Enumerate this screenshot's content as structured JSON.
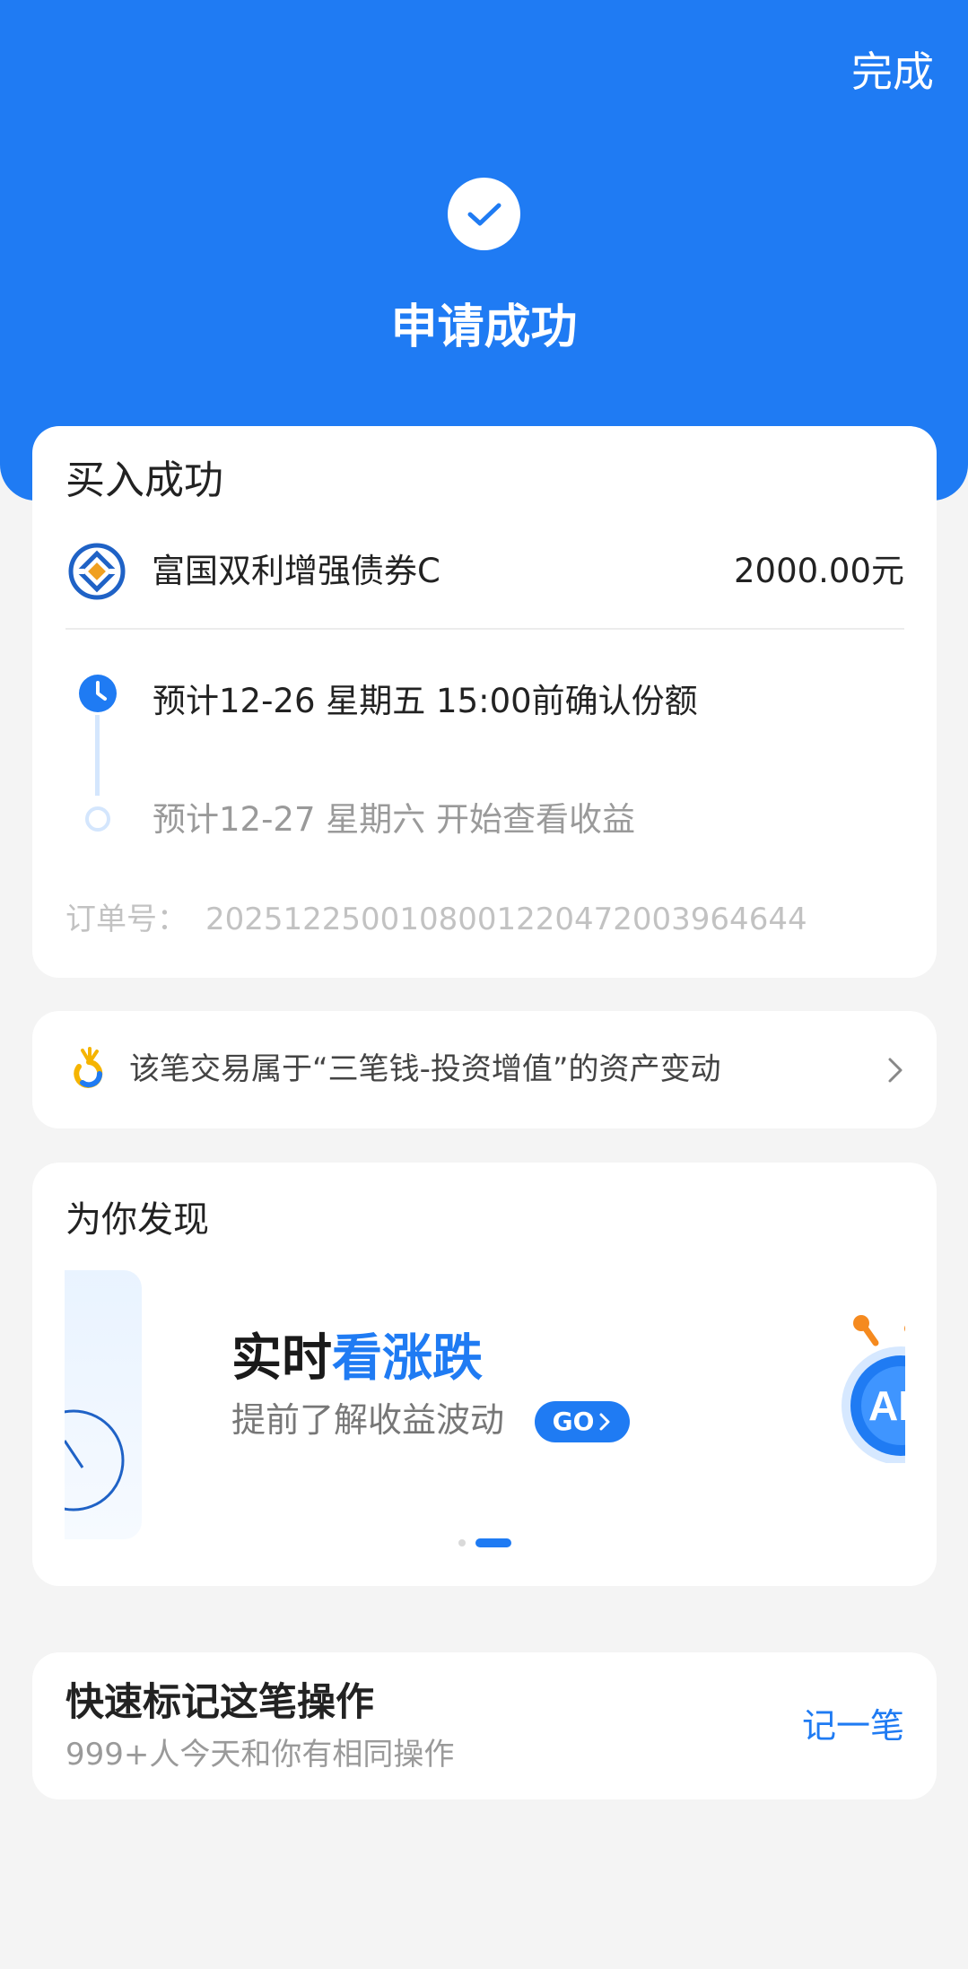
{
  "header": {
    "done_label": "完成",
    "status_title": "申请成功"
  },
  "order": {
    "title": "买入成功",
    "fund_name": "富国双利增强债券C",
    "amount": "2000.00元",
    "steps": [
      {
        "text": "预计12-26 星期五 15:00前确认份额",
        "active": true
      },
      {
        "text": "预计12-27 星期六 开始查看收益",
        "active": false
      }
    ],
    "order_no_label": "订单号：",
    "order_no": "2025122500108001220472003964644"
  },
  "asset_notice": {
    "text": "该笔交易属于“三笔钱-投资增值”的资产变动"
  },
  "discover": {
    "title": "为你发现",
    "banner": {
      "headline_part1": "实时",
      "headline_part2": "看涨跌",
      "subtitle": "提前了解收益波动",
      "go_label": "GO",
      "ai_badge": "AI"
    },
    "carousel": {
      "count": 2,
      "active_index": 1
    }
  },
  "quick_mark": {
    "title": "快速标记这笔操作",
    "subtitle": "999+人今天和你有相同操作",
    "action_label": "记一笔"
  },
  "colors": {
    "brand_blue": "#1f7bf3",
    "background": "#f4f4f4",
    "muted_text": "#9a9a9a"
  }
}
